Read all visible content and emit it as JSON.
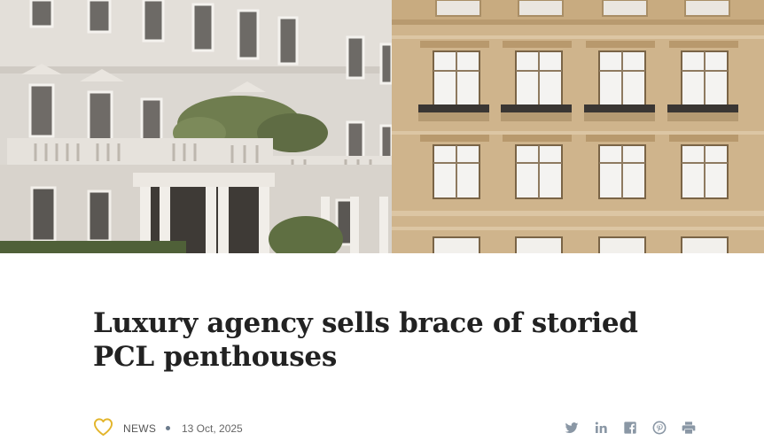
{
  "article": {
    "title": "Luxury agency sells brace of storied PCL penthouses",
    "category": "NEWS",
    "date": "13 Oct, 2025"
  },
  "icons": {
    "favorite": "heart-outline-icon",
    "share": [
      "twitter-icon",
      "linkedin-icon",
      "facebook-icon",
      "pinterest-icon",
      "print-icon"
    ]
  },
  "colors": {
    "heart": "#e3b52b",
    "title": "#222222",
    "meta_text": "#555555",
    "share_icons": "#8a97a5"
  }
}
